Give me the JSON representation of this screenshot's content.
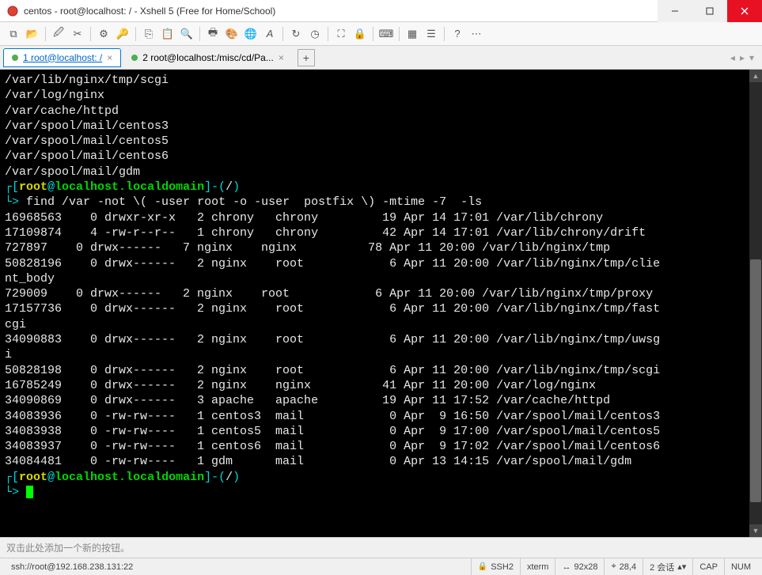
{
  "window": {
    "title": "centos - root@localhost: / - Xshell 5 (Free for Home/School)"
  },
  "tabs": [
    {
      "label": "1 root@localhost: /",
      "active": true
    },
    {
      "label": "2 root@localhost:/misc/cd/Pa...",
      "active": false
    }
  ],
  "terminal": {
    "plain_lines": [
      "/var/lib/nginx/tmp/scgi",
      "/var/log/nginx",
      "/var/cache/httpd",
      "/var/spool/mail/centos3",
      "/var/spool/mail/centos5",
      "/var/spool/mail/centos6",
      "/var/spool/mail/gdm"
    ],
    "prompt_user": "root",
    "prompt_at": "@",
    "prompt_host": "localhost.localdomain",
    "prompt_path": "/",
    "command": "find /var -not \\( -user root -o -user  postfix \\) -mtime -7  -ls",
    "listing_lines": [
      "16968563    0 drwxr-xr-x   2 chrony   chrony         19 Apr 14 17:01 /var/lib/chrony",
      "17109874    4 -rw-r--r--   1 chrony   chrony         42 Apr 14 17:01 /var/lib/chrony/drift",
      "727897    0 drwx------   7 nginx    nginx          78 Apr 11 20:00 /var/lib/nginx/tmp",
      "50828196    0 drwx------   2 nginx    root            6 Apr 11 20:00 /var/lib/nginx/tmp/clie",
      "nt_body",
      "729009    0 drwx------   2 nginx    root            6 Apr 11 20:00 /var/lib/nginx/tmp/proxy",
      "17157736    0 drwx------   2 nginx    root            6 Apr 11 20:00 /var/lib/nginx/tmp/fast",
      "cgi",
      "34090883    0 drwx------   2 nginx    root            6 Apr 11 20:00 /var/lib/nginx/tmp/uwsg",
      "i",
      "50828198    0 drwx------   2 nginx    root            6 Apr 11 20:00 /var/lib/nginx/tmp/scgi",
      "16785249    0 drwx------   2 nginx    nginx          41 Apr 11 20:00 /var/log/nginx",
      "34090869    0 drwx------   3 apache   apache         19 Apr 11 17:52 /var/cache/httpd",
      "34083936    0 -rw-rw----   1 centos3  mail            0 Apr  9 16:50 /var/spool/mail/centos3",
      "34083938    0 -rw-rw----   1 centos5  mail            0 Apr  9 17:00 /var/spool/mail/centos5",
      "34083937    0 -rw-rw----   1 centos6  mail            0 Apr  9 17:02 /var/spool/mail/centos6",
      "34084481    0 -rw-rw----   1 gdm      mail            0 Apr 13 14:15 /var/spool/mail/gdm"
    ]
  },
  "button_area_hint": "双击此处添加一个新的按钮。",
  "status": {
    "conn": "ssh://root@192.168.238.131:22",
    "ssh": "SSH2",
    "term": "xterm",
    "size": "92x28",
    "pos": "28,4",
    "sess": "2 会话",
    "caps": "CAP",
    "num": "NUM"
  }
}
